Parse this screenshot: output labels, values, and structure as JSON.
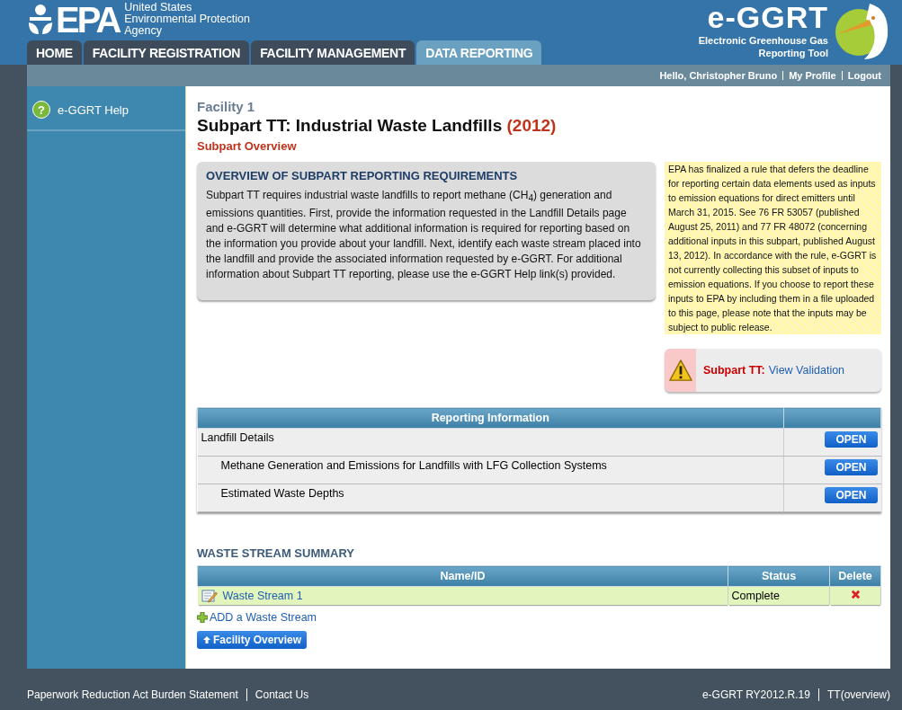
{
  "header": {
    "agency_lines": [
      "United States",
      "Environmental Protection",
      "Agency"
    ],
    "logo_text": "EPA",
    "app_logo": "e-GGRT",
    "app_name_lines": [
      "Electronic Greenhouse Gas",
      "Reporting Tool"
    ]
  },
  "tabs": [
    {
      "label": "HOME",
      "selected": false
    },
    {
      "label": "FACILITY REGISTRATION",
      "selected": false
    },
    {
      "label": "FACILITY MANAGEMENT",
      "selected": false
    },
    {
      "label": "DATA REPORTING",
      "selected": true
    }
  ],
  "user_links": [
    "Hello, Christopher Bruno",
    "My Profile",
    "Logout"
  ],
  "sidebar": {
    "items": [
      {
        "label": "e-GGRT Help",
        "icon": "?"
      }
    ]
  },
  "facility": "Facility 1",
  "title": "Subpart TT: Industrial Waste Landfills",
  "year": "(2012)",
  "subtitle": "Subpart Overview",
  "overview": {
    "heading": "OVERVIEW OF SUBPART REPORTING REQUIREMENTS",
    "text": "Subpart TT requires industrial waste landfills to report methane (CH$_{4}$) generation and emissions quantities. First, provide the information requested in the Landfill Details page and e-GGRT will determine what additional information is required for reporting based on the information you provide about your landfill. Next, identify each waste stream placed into the landfill and provide the associated information requested by e-GGRT. For additional information about Subpart TT reporting, please use the e-GGRT Help link(s) provided."
  },
  "notice": "EPA has finalized a rule that defers the deadline for reporting certain data elements used as inputs to emission equations for direct emitters until March 31, 2015. See 76 FR 53057 (published August 25, 2011) and 77 FR 48072 (concerning additional inputs in this subpart, published August 13, 2012). In accordance with the rule, e-GGRT is not currently collecting this subset of inputs to emission equations. If you choose to report these inputs to EPA by including them in a file uploaded to this page, please note that the inputs may be subject to public release.",
  "validation": {
    "label": "Subpart TT:",
    "link": "View Validation"
  },
  "reporting_table": {
    "columns": [
      "Reporting Information"
    ],
    "rows": [
      {
        "label": "Landfill Details",
        "button": "OPEN",
        "children": [
          {
            "label": "Methane Generation and Emissions for Landfills with LFG Collection Systems",
            "button": "OPEN"
          },
          {
            "label": "Estimated Waste Depths",
            "button": "OPEN"
          }
        ]
      }
    ]
  },
  "waste_stream_summary": {
    "heading": "WASTE STREAM SUMMARY",
    "columns": [
      "Name/ID",
      "Status",
      "Delete"
    ],
    "rows": [
      {
        "name": "Waste Stream 1",
        "status": "Complete"
      }
    ],
    "add_link": "ADD a Waste Stream"
  },
  "back_button": "Facility Overview",
  "footer": {
    "left": [
      "Paperwork Reduction Act Burden Statement",
      "Contact Us"
    ],
    "right": [
      "e-GGRT RY2012.R.19",
      "TT(overview)"
    ]
  }
}
